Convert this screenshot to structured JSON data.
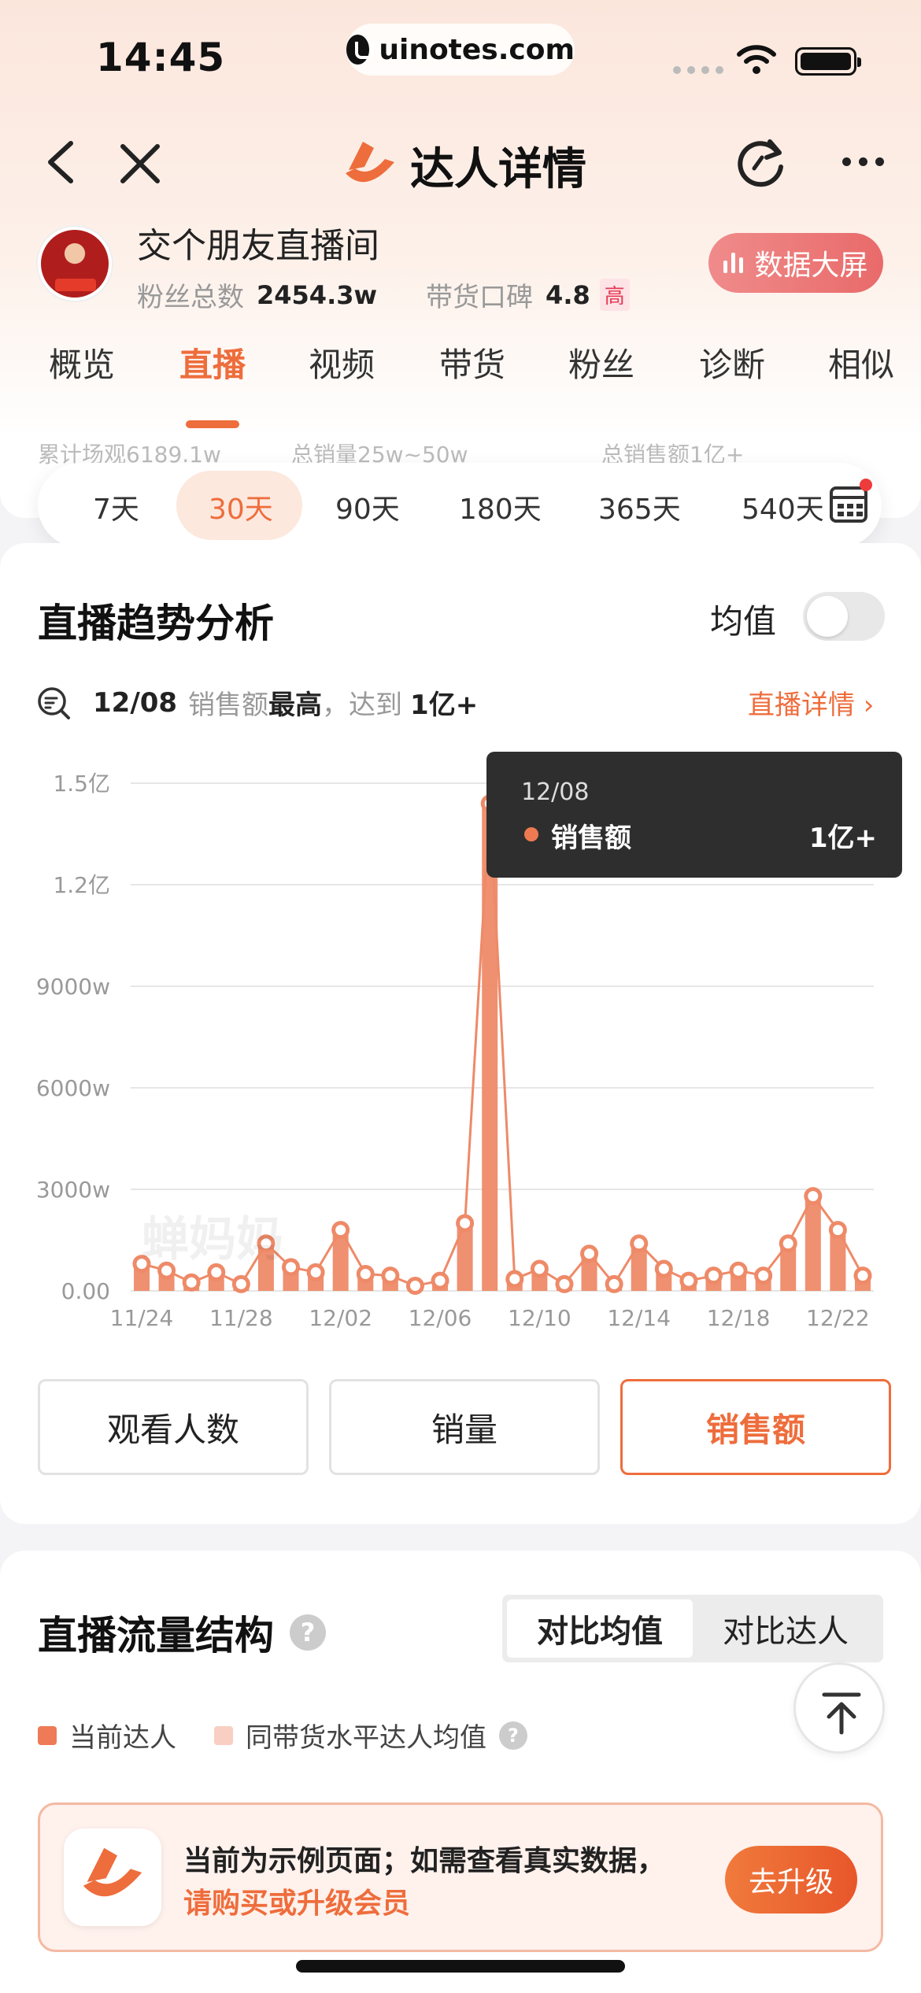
{
  "status_bar": {
    "time": "14:45",
    "url": "uinotes.com"
  },
  "nav": {
    "title": "达人详情"
  },
  "profile": {
    "name": "交个朋友直播间",
    "fans_label": "粉丝总数",
    "fans_value": "2454.3w",
    "reputation_label": "带货口碑",
    "reputation_value": "4.8",
    "reputation_level": "高",
    "big_screen_label": "数据大屏"
  },
  "tabs": [
    "概览",
    "直播",
    "视频",
    "带货",
    "粉丝",
    "诊断",
    "相似"
  ],
  "active_tab": "直播",
  "summary_ghost": [
    "累计场观6189.1w",
    "总销量25w~50w",
    "总销售额1亿+"
  ],
  "day_ranges": [
    "7天",
    "30天",
    "90天",
    "180天",
    "365天",
    "540天"
  ],
  "active_range": "30天",
  "trend": {
    "title": "直播趋势分析",
    "toggle_label": "均值",
    "insight_date": "12/08",
    "insight_metric": "销售额",
    "insight_highest": "最高",
    "insight_reach": "，达到",
    "insight_value": "1亿+",
    "detail_link": "直播详情 ›",
    "tooltip": {
      "date": "12/08",
      "name": "销售额",
      "value": "1亿+"
    },
    "watermark": "蝉妈妈"
  },
  "chart_data": {
    "type": "bar",
    "series": [
      {
        "name": "销售额",
        "color": "#ee8a68"
      }
    ],
    "y_ticks": [
      "0.00",
      "3000w",
      "6000w",
      "9000w",
      "1.2亿",
      "1.5亿"
    ],
    "ylim": [
      0,
      15000
    ],
    "y_unit": "w",
    "x_ticks": [
      "11/24",
      "11/28",
      "12/02",
      "12/06",
      "12/10",
      "12/14",
      "12/18",
      "12/22"
    ],
    "categories": [
      "11/24",
      "11/25",
      "11/26",
      "11/27",
      "11/28",
      "11/29",
      "11/30",
      "12/01",
      "12/02",
      "12/03",
      "12/04",
      "12/05",
      "12/06",
      "12/07",
      "12/08",
      "12/09",
      "12/10",
      "12/11",
      "12/12",
      "12/13",
      "12/14",
      "12/15",
      "12/16",
      "12/17",
      "12/18",
      "12/19",
      "12/20",
      "12/21",
      "12/22",
      "12/23"
    ],
    "values": [
      800,
      600,
      250,
      550,
      200,
      1400,
      700,
      550,
      1800,
      500,
      450,
      150,
      300,
      2000,
      14400,
      350,
      650,
      200,
      1100,
      200,
      1400,
      650,
      300,
      450,
      600,
      450,
      1400,
      2800,
      1800,
      450
    ],
    "highlight_index": 14
  },
  "metric_buttons": [
    "观看人数",
    "销量",
    "销售额"
  ],
  "active_metric": "销售额",
  "traffic": {
    "title": "直播流量结构",
    "segments": [
      "对比均值",
      "对比达人"
    ],
    "active_segment": "对比均值",
    "legend": [
      {
        "label": "当前达人",
        "color": "#ee7a58"
      },
      {
        "label": "同带货水平达人均值",
        "color": "#f8cfc2"
      }
    ]
  },
  "banner": {
    "line1": "当前为示例页面；如需查看真实数据，",
    "line2": "请购买或升级会员",
    "button": "去升级"
  },
  "colors": {
    "accent": "#ee6d3c"
  }
}
